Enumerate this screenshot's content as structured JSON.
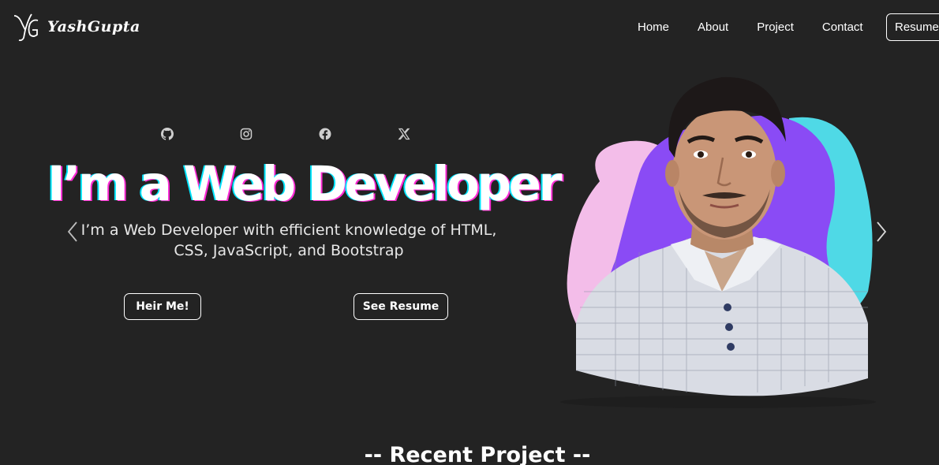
{
  "brand": {
    "logo_icon": "yg-monogram-icon",
    "name": "YashGupta"
  },
  "nav": {
    "links": [
      "Home",
      "About",
      "Project",
      "Contact"
    ],
    "resume_label": "Resume"
  },
  "social": [
    {
      "icon": "github-icon"
    },
    {
      "icon": "instagram-icon"
    },
    {
      "icon": "facebook-icon"
    },
    {
      "icon": "x-twitter-icon"
    }
  ],
  "hero": {
    "title": "I’m a Web Developer",
    "description": "I’m a Web Developer with efficient knowledge of HTML, CSS, JavaScript, and Bootstrap",
    "hire_button": "Heir Me!",
    "resume_button": "See Resume",
    "prev_icon": "chevron-left-icon",
    "next_icon": "chevron-right-icon"
  },
  "portrait": {
    "image": "profile-photo",
    "blob_colors": [
      "#f3bde9",
      "#8a4bf5",
      "#4fd9e6"
    ]
  },
  "sections": {
    "recent_project_title": "-- Recent Project --"
  },
  "colors": {
    "background": "#232323",
    "text": "#ffffff",
    "title_shadow_cyan": "#00e5ff",
    "title_shadow_pink": "#ff2bd6"
  }
}
